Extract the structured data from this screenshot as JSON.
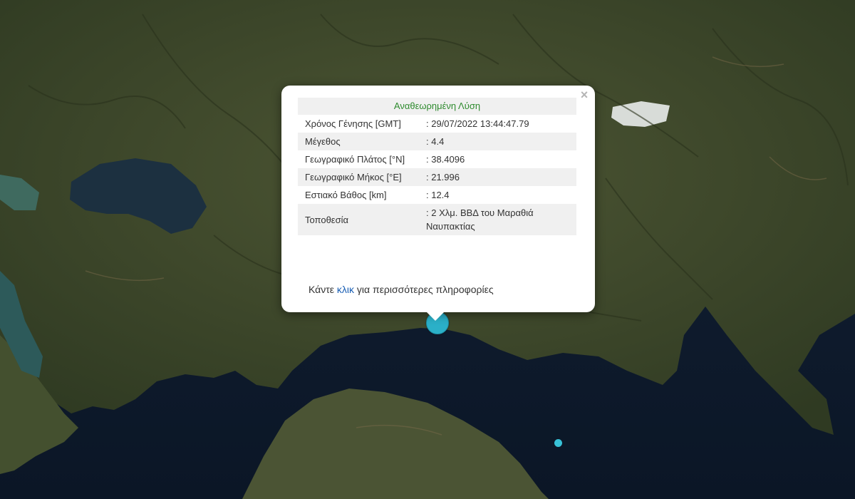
{
  "popup": {
    "title": "Αναθεωρημένη Λύση",
    "rows": [
      {
        "label": "Χρόνος Γένησης [GMT]",
        "value": ": 29/07/2022 13:44:47.79"
      },
      {
        "label": "Μέγεθος",
        "value": ": 4.4"
      },
      {
        "label": "Γεωγραφικό Πλάτος [°N]",
        "value": ": 38.4096"
      },
      {
        "label": "Γεωγραφικό Μήκος [°E]",
        "value": ": 21.996"
      },
      {
        "label": "Εστιακό Βάθος [km]",
        "value": ": 12.4"
      },
      {
        "label": "Τοποθεσία",
        "value": ": 2 Χλμ. ΒΒΔ του Μαραθιά Ναυπακτίας"
      }
    ],
    "more_prefix": "Κάντε ",
    "more_link": "κλικ",
    "more_suffix": " για περισσότερες πληροφορίες",
    "close_symbol": "×"
  },
  "colors": {
    "sea": "#0e1a2c",
    "land": "#3f4a2b",
    "marker": "#2bb0c8",
    "title_text": "#2e8b2e",
    "link": "#1a5fb4"
  }
}
